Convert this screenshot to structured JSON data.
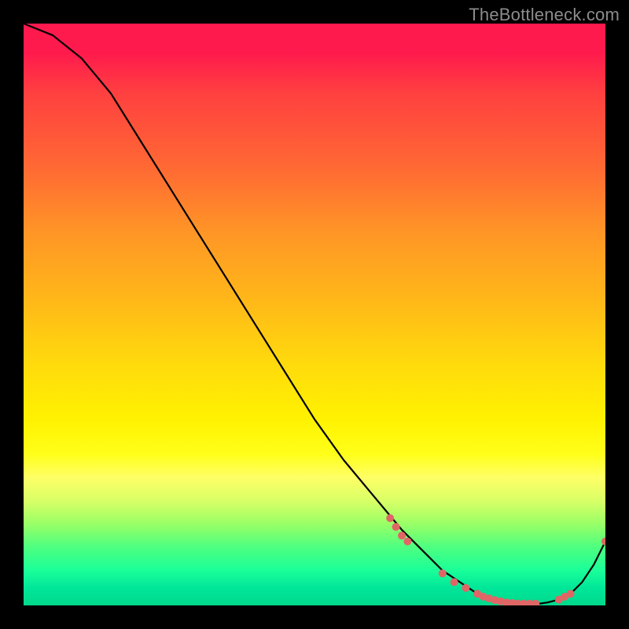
{
  "watermark": "TheBottleneck.com",
  "chart_data": {
    "type": "line",
    "title": "",
    "xlabel": "",
    "ylabel": "",
    "xlim": [
      0,
      100
    ],
    "ylim": [
      0,
      100
    ],
    "grid": false,
    "legend": false,
    "colors": {
      "background_gradient_top": "#ff1a4d",
      "background_gradient_mid": "#ffff00",
      "background_gradient_bottom": "#00d98c",
      "curve": "#000000",
      "markers": "#e06666"
    },
    "series": [
      {
        "name": "bottleneck-curve",
        "type": "line",
        "x": [
          0,
          5,
          10,
          15,
          20,
          25,
          30,
          35,
          40,
          45,
          50,
          55,
          60,
          65,
          70,
          72,
          75,
          78,
          80,
          82,
          84,
          86,
          88,
          90,
          92,
          94,
          96,
          98,
          100
        ],
        "y": [
          100,
          98,
          94,
          88,
          80,
          72,
          64,
          56,
          48,
          40,
          32,
          25,
          19,
          13,
          8,
          6,
          4,
          2,
          1,
          0.5,
          0.3,
          0.2,
          0.2,
          0.5,
          1,
          2,
          4,
          7,
          11
        ]
      },
      {
        "name": "markers",
        "type": "scatter",
        "x": [
          63,
          64,
          65,
          66,
          72,
          74,
          76,
          78,
          79,
          80,
          81,
          82,
          83,
          84,
          85,
          86,
          87,
          88,
          92,
          93,
          94,
          100
        ],
        "y": [
          15,
          13.5,
          12,
          11,
          5.5,
          4,
          3,
          2,
          1.5,
          1.2,
          0.9,
          0.7,
          0.5,
          0.4,
          0.3,
          0.3,
          0.3,
          0.3,
          1,
          1.5,
          2,
          11
        ]
      }
    ]
  }
}
